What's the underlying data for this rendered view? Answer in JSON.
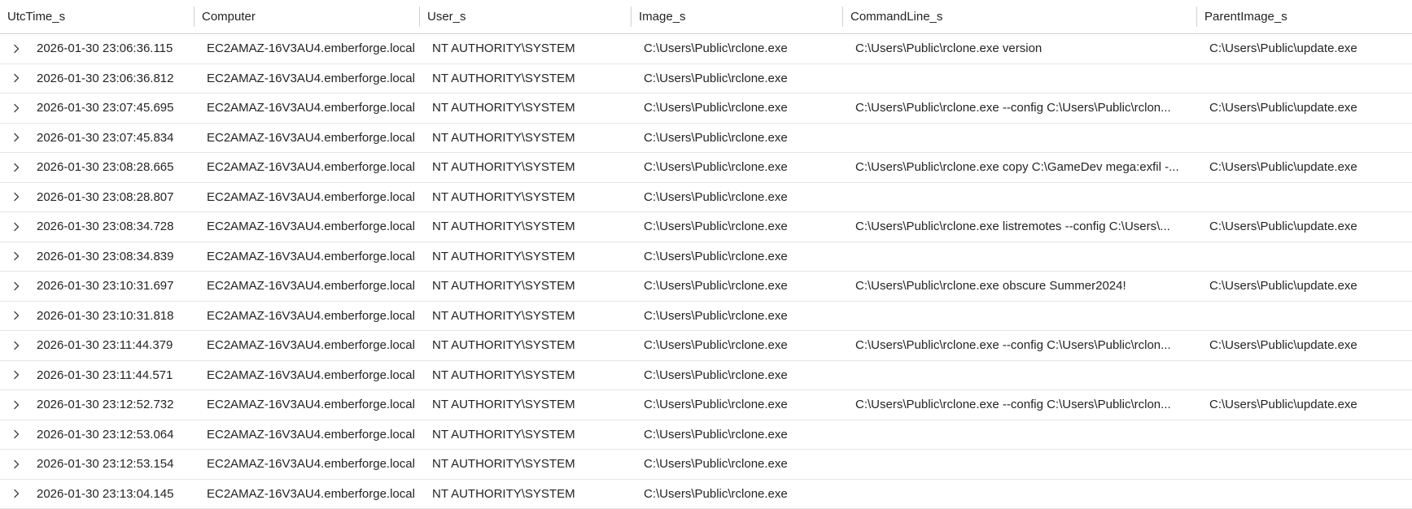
{
  "columns": {
    "utc_time": "UtcTime_s",
    "computer": "Computer",
    "user": "User_s",
    "image": "Image_s",
    "command_line": "CommandLine_s",
    "parent_image": "ParentImage_s"
  },
  "rows": [
    {
      "utc": "2026-01-30 23:06:36.115",
      "computer": "EC2AMAZ-16V3AU4.emberforge.local",
      "user": "NT AUTHORITY\\SYSTEM",
      "image": "C:\\Users\\Public\\rclone.exe",
      "cmd": "C:\\Users\\Public\\rclone.exe version",
      "parent": "C:\\Users\\Public\\update.exe"
    },
    {
      "utc": "2026-01-30 23:06:36.812",
      "computer": "EC2AMAZ-16V3AU4.emberforge.local",
      "user": "NT AUTHORITY\\SYSTEM",
      "image": "C:\\Users\\Public\\rclone.exe",
      "cmd": "",
      "parent": ""
    },
    {
      "utc": "2026-01-30 23:07:45.695",
      "computer": "EC2AMAZ-16V3AU4.emberforge.local",
      "user": "NT AUTHORITY\\SYSTEM",
      "image": "C:\\Users\\Public\\rclone.exe",
      "cmd": "C:\\Users\\Public\\rclone.exe --config C:\\Users\\Public\\rclon...",
      "parent": "C:\\Users\\Public\\update.exe"
    },
    {
      "utc": "2026-01-30 23:07:45.834",
      "computer": "EC2AMAZ-16V3AU4.emberforge.local",
      "user": "NT AUTHORITY\\SYSTEM",
      "image": "C:\\Users\\Public\\rclone.exe",
      "cmd": "",
      "parent": ""
    },
    {
      "utc": "2026-01-30 23:08:28.665",
      "computer": "EC2AMAZ-16V3AU4.emberforge.local",
      "user": "NT AUTHORITY\\SYSTEM",
      "image": "C:\\Users\\Public\\rclone.exe",
      "cmd": "C:\\Users\\Public\\rclone.exe copy C:\\GameDev mega:exfil -...",
      "parent": "C:\\Users\\Public\\update.exe"
    },
    {
      "utc": "2026-01-30 23:08:28.807",
      "computer": "EC2AMAZ-16V3AU4.emberforge.local",
      "user": "NT AUTHORITY\\SYSTEM",
      "image": "C:\\Users\\Public\\rclone.exe",
      "cmd": "",
      "parent": ""
    },
    {
      "utc": "2026-01-30 23:08:34.728",
      "computer": "EC2AMAZ-16V3AU4.emberforge.local",
      "user": "NT AUTHORITY\\SYSTEM",
      "image": "C:\\Users\\Public\\rclone.exe",
      "cmd": "C:\\Users\\Public\\rclone.exe listremotes --config C:\\Users\\...",
      "parent": "C:\\Users\\Public\\update.exe"
    },
    {
      "utc": "2026-01-30 23:08:34.839",
      "computer": "EC2AMAZ-16V3AU4.emberforge.local",
      "user": "NT AUTHORITY\\SYSTEM",
      "image": "C:\\Users\\Public\\rclone.exe",
      "cmd": "",
      "parent": ""
    },
    {
      "utc": "2026-01-30 23:10:31.697",
      "computer": "EC2AMAZ-16V3AU4.emberforge.local",
      "user": "NT AUTHORITY\\SYSTEM",
      "image": "C:\\Users\\Public\\rclone.exe",
      "cmd": "C:\\Users\\Public\\rclone.exe obscure Summer2024!",
      "parent": "C:\\Users\\Public\\update.exe"
    },
    {
      "utc": "2026-01-30 23:10:31.818",
      "computer": "EC2AMAZ-16V3AU4.emberforge.local",
      "user": "NT AUTHORITY\\SYSTEM",
      "image": "C:\\Users\\Public\\rclone.exe",
      "cmd": "",
      "parent": ""
    },
    {
      "utc": "2026-01-30 23:11:44.379",
      "computer": "EC2AMAZ-16V3AU4.emberforge.local",
      "user": "NT AUTHORITY\\SYSTEM",
      "image": "C:\\Users\\Public\\rclone.exe",
      "cmd": "C:\\Users\\Public\\rclone.exe --config C:\\Users\\Public\\rclon...",
      "parent": "C:\\Users\\Public\\update.exe"
    },
    {
      "utc": "2026-01-30 23:11:44.571",
      "computer": "EC2AMAZ-16V3AU4.emberforge.local",
      "user": "NT AUTHORITY\\SYSTEM",
      "image": "C:\\Users\\Public\\rclone.exe",
      "cmd": "",
      "parent": ""
    },
    {
      "utc": "2026-01-30 23:12:52.732",
      "computer": "EC2AMAZ-16V3AU4.emberforge.local",
      "user": "NT AUTHORITY\\SYSTEM",
      "image": "C:\\Users\\Public\\rclone.exe",
      "cmd": "C:\\Users\\Public\\rclone.exe --config C:\\Users\\Public\\rclon...",
      "parent": "C:\\Users\\Public\\update.exe"
    },
    {
      "utc": "2026-01-30 23:12:53.064",
      "computer": "EC2AMAZ-16V3AU4.emberforge.local",
      "user": "NT AUTHORITY\\SYSTEM",
      "image": "C:\\Users\\Public\\rclone.exe",
      "cmd": "",
      "parent": ""
    },
    {
      "utc": "2026-01-30 23:12:53.154",
      "computer": "EC2AMAZ-16V3AU4.emberforge.local",
      "user": "NT AUTHORITY\\SYSTEM",
      "image": "C:\\Users\\Public\\rclone.exe",
      "cmd": "",
      "parent": ""
    },
    {
      "utc": "2026-01-30 23:13:04.145",
      "computer": "EC2AMAZ-16V3AU4.emberforge.local",
      "user": "NT AUTHORITY\\SYSTEM",
      "image": "C:\\Users\\Public\\rclone.exe",
      "cmd": "",
      "parent": ""
    }
  ]
}
